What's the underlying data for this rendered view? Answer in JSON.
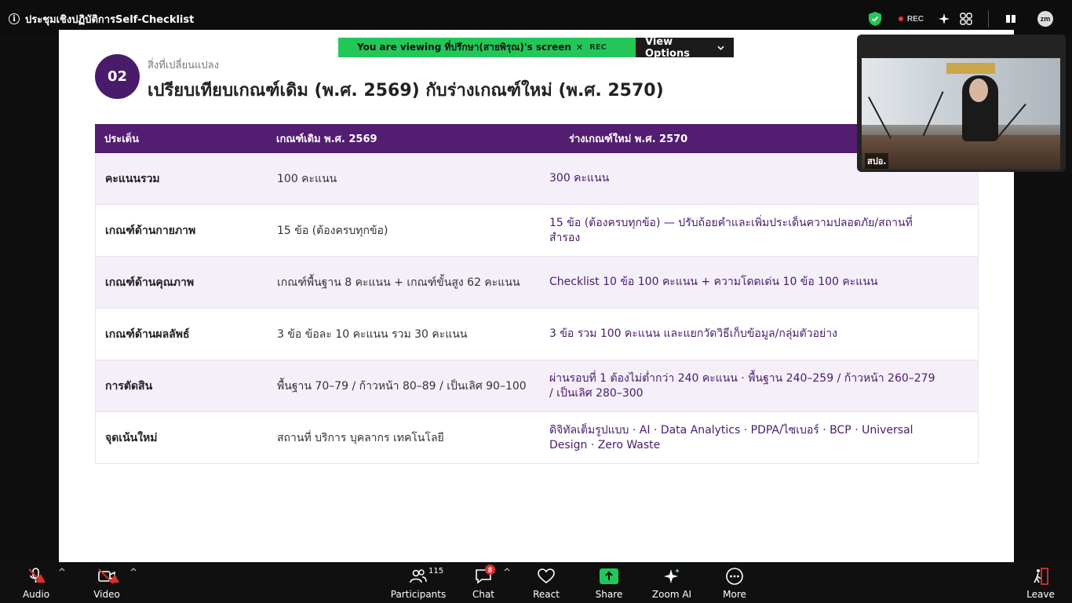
{
  "window": {
    "title": "ประชุมเชิงปฏิบัติการSelf-Checklist",
    "rec_label": "REC",
    "avatar": "zm"
  },
  "banner": {
    "viewing_text": "You are viewing  ที่ปรึกษา(สายพิรุณ)'s screen",
    "rec_label": "REC",
    "view_options": "View Options"
  },
  "video": {
    "participant_name": "สปอ."
  },
  "slide": {
    "badge": "02",
    "section_label": "สิ่งที่เปลี่ยนแปลง",
    "title": "เปรียบเทียบเกณฑ์เดิม (พ.ศ. 2569) กับร่างเกณฑ์ใหม่ (พ.ศ. 2570)",
    "columns": [
      "ประเด็น",
      "เกณฑ์เดิม พ.ศ. 2569",
      "ร่างเกณฑ์ใหม่ พ.ศ. 2570"
    ],
    "rows": [
      {
        "topic": "คะแนนรวม",
        "old": "100 คะแนน",
        "new": "300 คะแนน"
      },
      {
        "topic": "เกณฑ์ด้านกายภาพ",
        "old": "15 ข้อ (ต้องครบทุกข้อ)",
        "new": "15 ข้อ (ต้องครบทุกข้อ) — ปรับถ้อยคำและเพิ่มประเด็นความปลอดภัย/สถานที่สำรอง"
      },
      {
        "topic": "เกณฑ์ด้านคุณภาพ",
        "old": "เกณฑ์พื้นฐาน 8 คะแนน + เกณฑ์ขั้นสูง 62 คะแนน",
        "new": "Checklist 10 ข้อ 100 คะแนน + ความโดดเด่น 10 ข้อ 100 คะแนน"
      },
      {
        "topic": "เกณฑ์ด้านผลลัพธ์",
        "old": "3 ข้อ ข้อละ 10 คะแนน รวม 30 คะแนน",
        "new": "3 ข้อ รวม 100 คะแนน และแยกวัดวิธีเก็บข้อมูล/กลุ่มตัวอย่าง"
      },
      {
        "topic": "การตัดสิน",
        "old": "พื้นฐาน 70–79 / ก้าวหน้า 80–89 / เป็นเลิศ 90–100",
        "new": "ผ่านรอบที่ 1 ต้องไม่ต่ำกว่า 240 คะแนน · พื้นฐาน 240–259 / ก้าวหน้า 260–279 / เป็นเลิศ 280–300"
      },
      {
        "topic": "จุดเน้นใหม่",
        "old": "สถานที่ บริการ บุคลากร เทคโนโลยี",
        "new": "ดิจิทัลเต็มรูปแบบ · AI · Data Analytics · PDPA/ไซเบอร์ · BCP · Universal Design · Zero Waste"
      }
    ]
  },
  "toolbar": {
    "audio": "Audio",
    "video": "Video",
    "participants": "Participants",
    "participants_count": "115",
    "chat": "Chat",
    "chat_badge": "8",
    "react": "React",
    "share": "Share",
    "zoom_ai": "Zoom AI",
    "more": "More",
    "leave": "Leave"
  },
  "colors": {
    "accent_purple": "#531d72",
    "banner_green": "#23c759",
    "alert_red": "#e02e2e"
  }
}
